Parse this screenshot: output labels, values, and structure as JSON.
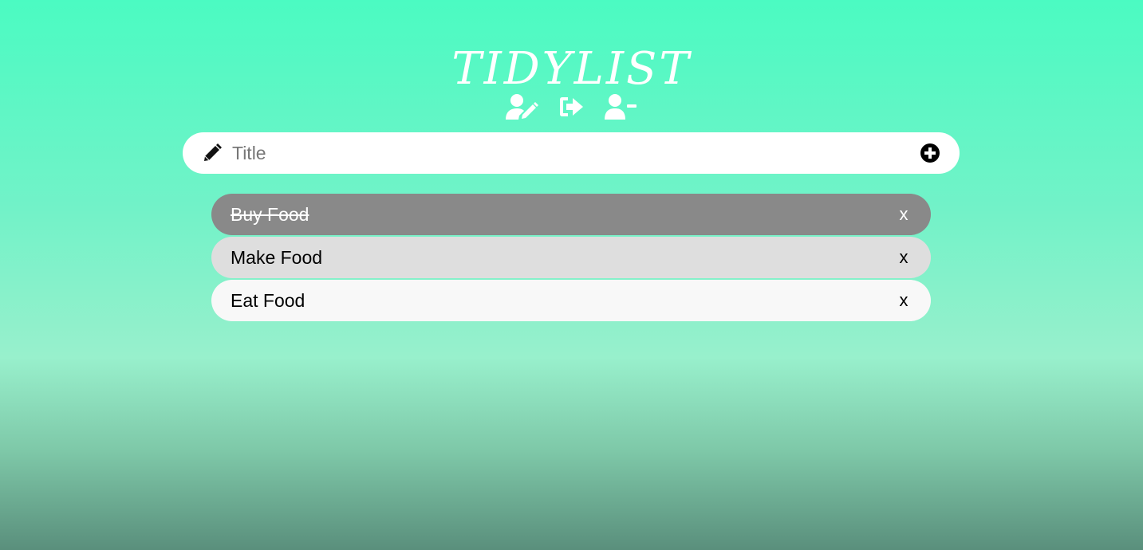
{
  "app": {
    "title": "TIDYLIST"
  },
  "toolbar": {
    "buttons": [
      {
        "icon": "user-edit-icon"
      },
      {
        "icon": "sign-out-icon"
      },
      {
        "icon": "user-minus-icon"
      }
    ]
  },
  "input": {
    "placeholder": "Title",
    "value": "",
    "leading_icon": "pencil-icon",
    "add_icon": "plus-circle-icon"
  },
  "todos": [
    {
      "label": "Buy Food",
      "completed": true,
      "delete_label": "x"
    },
    {
      "label": "Make Food",
      "completed": false,
      "delete_label": "x"
    },
    {
      "label": "Eat Food",
      "completed": false,
      "delete_label": "x"
    }
  ],
  "colors": {
    "accent": "#4bfbc2",
    "completed_bg": "#898989",
    "item_bg": "#dedede",
    "item_bg_light": "#f8f8f8"
  }
}
